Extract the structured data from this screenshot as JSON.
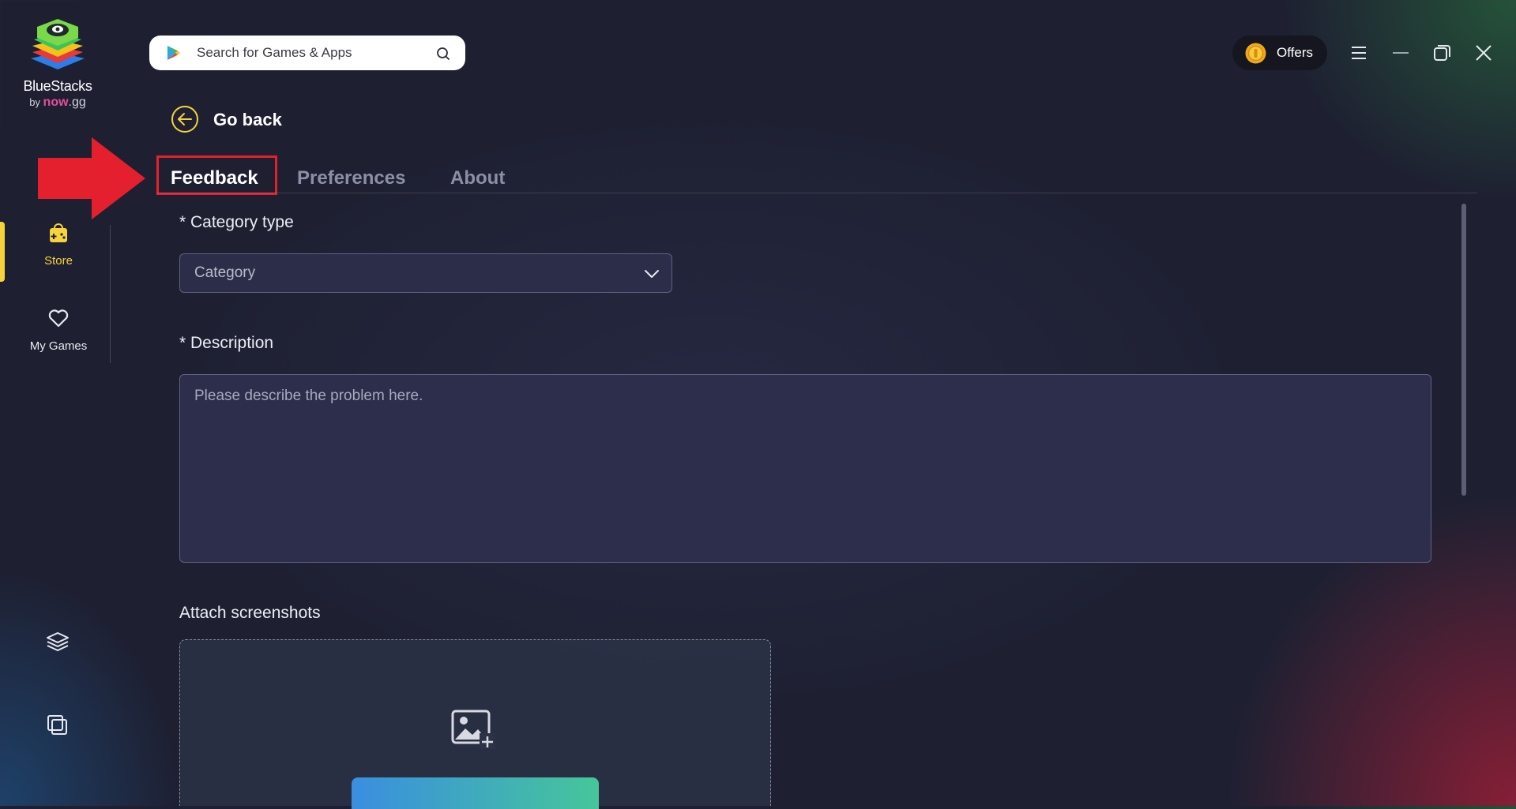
{
  "app": {
    "brand_name": "BlueStacks",
    "brand_by": "by",
    "brand_now": "now",
    "brand_gg": ".gg"
  },
  "search": {
    "placeholder": "Search for Games & Apps"
  },
  "topbar": {
    "offers_label": "Offers"
  },
  "sidebar": {
    "items": [
      {
        "label": "Store",
        "icon": "store-bag-icon",
        "active": true
      },
      {
        "label": "My Games",
        "icon": "heart-icon",
        "active": false
      }
    ],
    "bottom_icons": [
      "layers-icon",
      "multi-instance-icon"
    ]
  },
  "nav": {
    "go_back_label": "Go back"
  },
  "tabs": [
    {
      "label": "Feedback",
      "active": true
    },
    {
      "label": "Preferences",
      "active": false
    },
    {
      "label": "About",
      "active": false
    }
  ],
  "form": {
    "category_label": "* Category type",
    "category_value": "Category",
    "description_label": "* Description",
    "description_placeholder": "Please describe the problem here.",
    "attach_label": "Attach screenshots"
  },
  "colors": {
    "accent_yellow": "#f7d33b",
    "highlight_red": "#e5202e",
    "background": "#1e2032"
  }
}
